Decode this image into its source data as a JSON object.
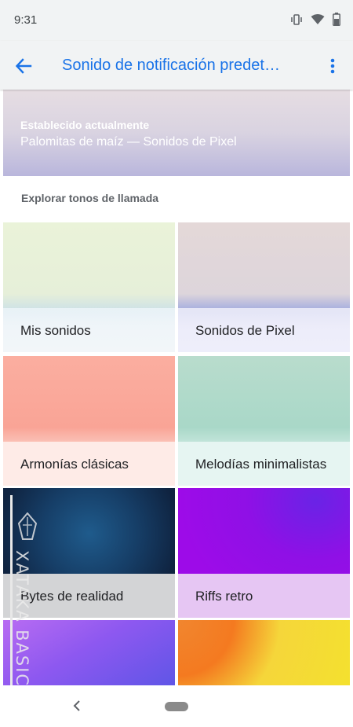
{
  "status_bar": {
    "time": "9:31",
    "icons": [
      "vibrate-icon",
      "wifi-icon",
      "battery-icon"
    ]
  },
  "app_bar": {
    "title": "Sonido de notificación predet…",
    "accent_color": "#1a73e8"
  },
  "current": {
    "label": "Establecido actualmente",
    "value": "Palomitas de maíz — Sonidos de Pixel"
  },
  "section": {
    "title": "Explorar tonos de llamada"
  },
  "categories": [
    {
      "label": "Mis sonidos"
    },
    {
      "label": "Sonidos de Pixel"
    },
    {
      "label": "Armonías clásicas"
    },
    {
      "label": "Melodías minimalistas"
    },
    {
      "label": "Bytes de realidad"
    },
    {
      "label": "Riffs retro"
    },
    {
      "label": ""
    },
    {
      "label": ""
    }
  ],
  "watermark": {
    "text": "XATAKA BASICS"
  }
}
